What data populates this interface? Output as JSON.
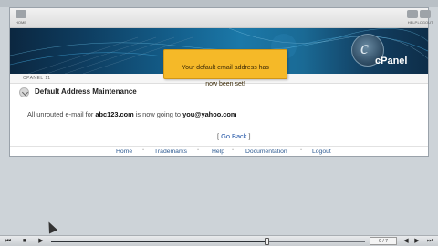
{
  "toolbar": {
    "home_label": "HOME",
    "help_label": "HELP",
    "logout_label": "LOGOUT"
  },
  "banner": {
    "logo_letter": "c",
    "logo_text": "cPanel"
  },
  "strip": {
    "label": "CPANEL 11"
  },
  "page": {
    "title": "Default Address Maintenance",
    "message_prefix": "All unrouted e-mail for ",
    "domain": "abc123.com",
    "message_middle": " is now going to ",
    "destination": "you@yahoo.com",
    "go_back_open": "[ ",
    "go_back_label": "Go Back",
    "go_back_close": " ]"
  },
  "notice": {
    "line1": "Your default email address has",
    "line2": "now been set!"
  },
  "footer": {
    "links": [
      "Home",
      "Trademarks",
      "Help",
      "Documentation",
      "Logout"
    ],
    "separator": "•"
  },
  "player": {
    "counter": "9 / 7",
    "progress_fraction": 0.69,
    "colors": {
      "accent": "#f5b928",
      "link": "#2d5a91"
    }
  }
}
